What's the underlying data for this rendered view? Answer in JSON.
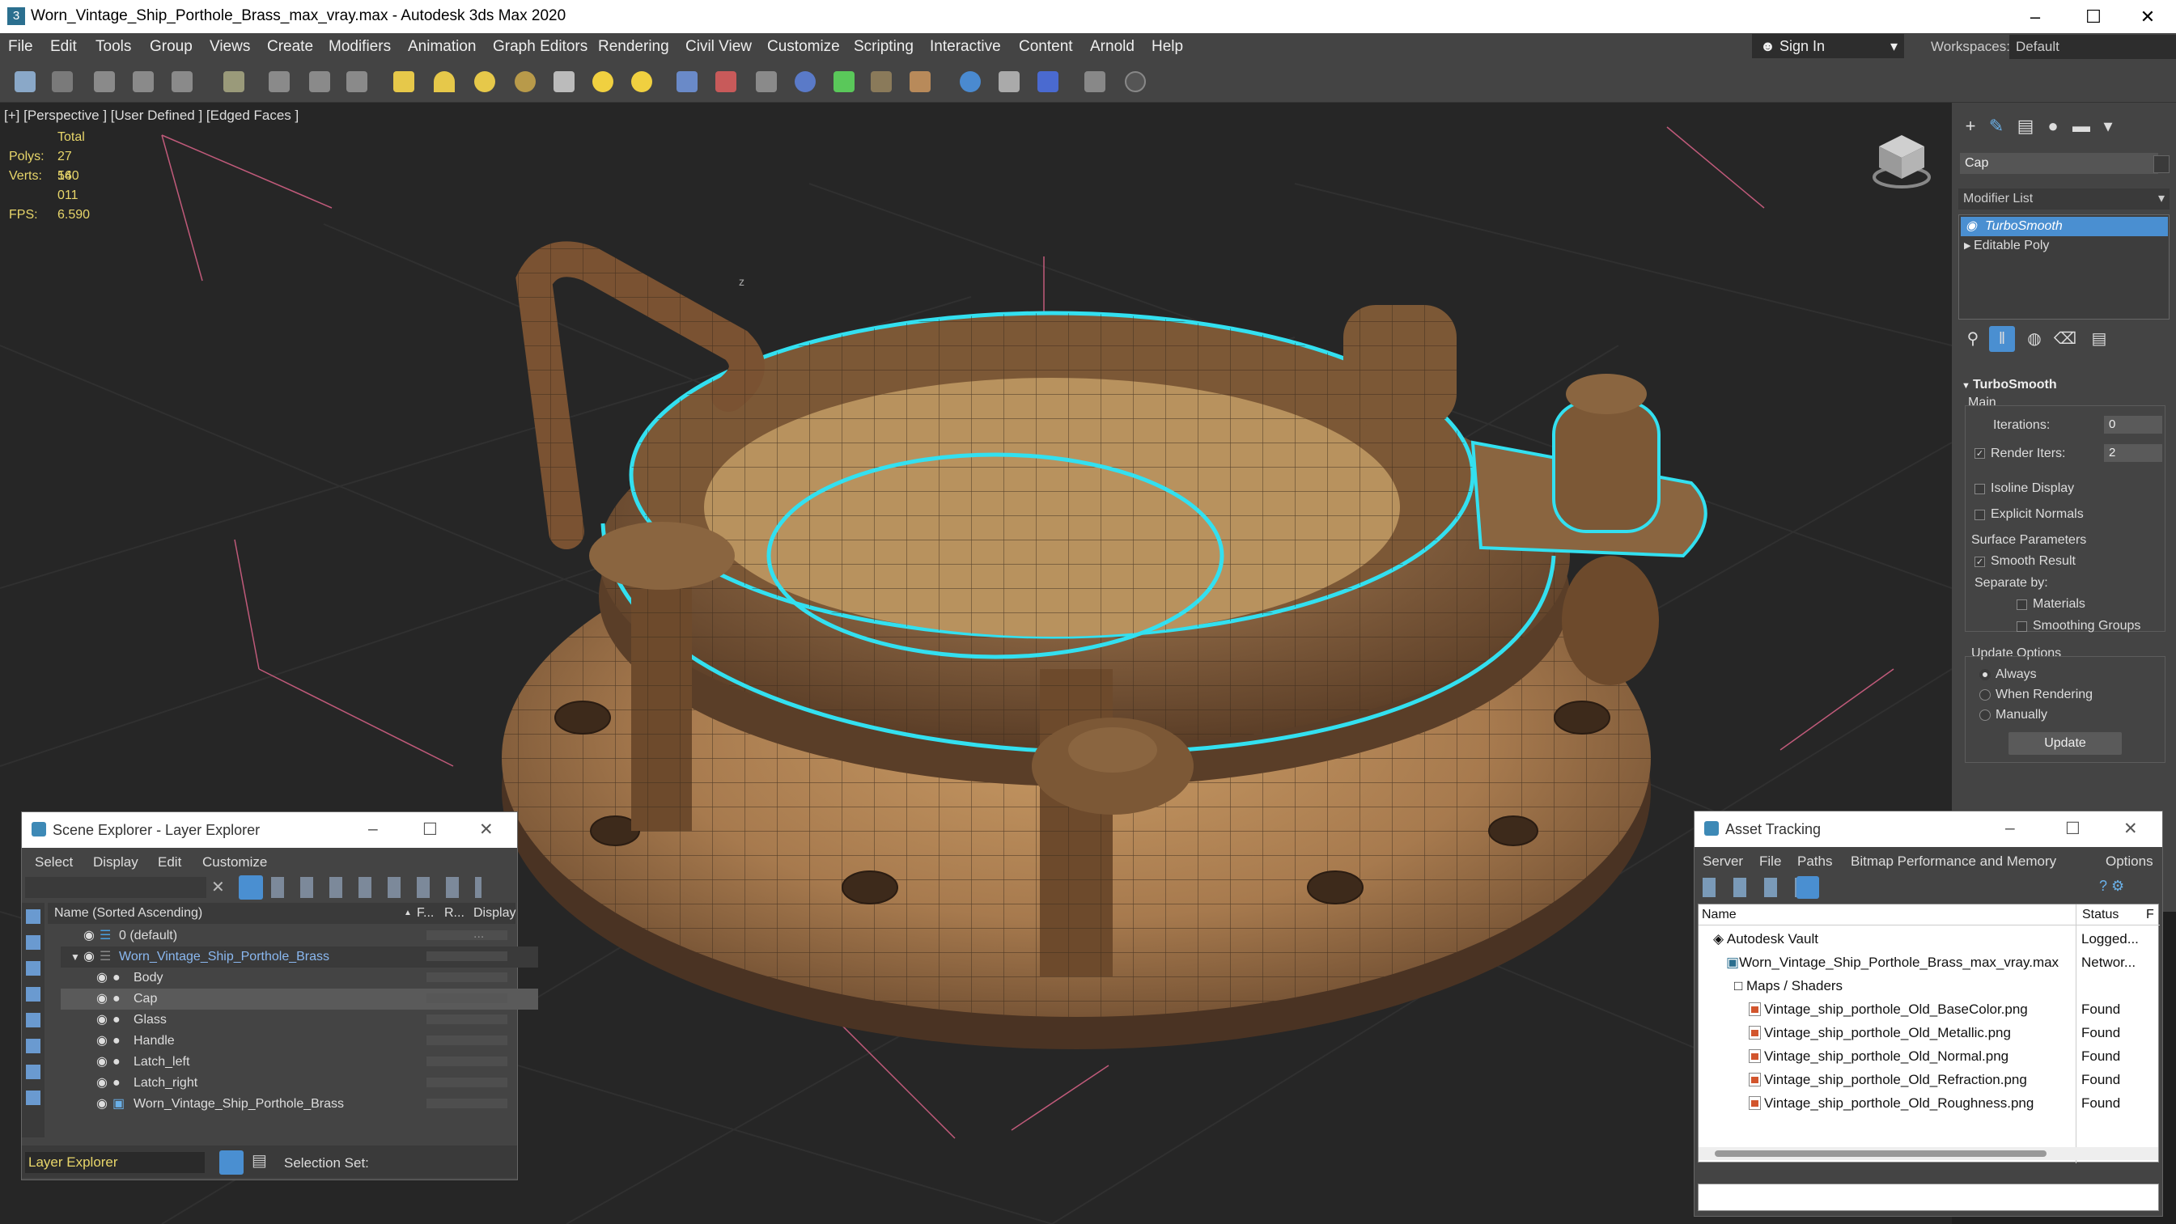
{
  "window": {
    "title": "Worn_Vintage_Ship_Porthole_Brass_max_vray.max - Autodesk 3ds Max 2020",
    "app_icon": "3",
    "minimize": "–",
    "maximize": "☐",
    "close": "✕"
  },
  "menu": [
    "File",
    "Edit",
    "Tools",
    "Group",
    "Views",
    "Create",
    "Modifiers",
    "Animation",
    "Graph Editors",
    "Rendering",
    "Civil View",
    "Customize",
    "Scripting",
    "Interactive",
    "Content",
    "Arnold",
    "Help"
  ],
  "account": {
    "signin": "Sign In",
    "workspaces_label": "Workspaces:",
    "workspace": "Default"
  },
  "viewport": {
    "label": "[+] [Perspective ] [User Defined ] [Edged Faces ]",
    "stats": {
      "total_label": "Total",
      "polys_label": "Polys:",
      "polys": "27 560",
      "verts_label": "Verts:",
      "verts": "14 011",
      "fps_label": "FPS:",
      "fps": "6.590"
    }
  },
  "command_panel": {
    "object_name": "Cap",
    "modifier_list_label": "Modifier List",
    "stack": [
      "TurboSmooth",
      "Editable Poly"
    ],
    "rollout": {
      "title": "TurboSmooth",
      "main_label": "Main",
      "iterations_label": "Iterations:",
      "iterations": "0",
      "render_iters_label": "Render Iters:",
      "render_iters": "2",
      "render_iters_checked": "✓",
      "isoline_label": "Isoline Display",
      "explicit_normals_label": "Explicit Normals",
      "surface_params_label": "Surface Parameters",
      "smooth_result_label": "Smooth Result",
      "smooth_result_checked": "✓",
      "separate_by_label": "Separate by:",
      "materials_label": "Materials",
      "smoothing_groups_label": "Smoothing Groups",
      "update_options_label": "Update Options",
      "always_label": "Always",
      "when_rendering_label": "When Rendering",
      "manually_label": "Manually",
      "update_button": "Update"
    }
  },
  "scene_explorer": {
    "title": "Scene Explorer - Layer Explorer",
    "menu": [
      "Select",
      "Display",
      "Edit",
      "Customize"
    ],
    "columns": {
      "name": "Name (Sorted Ascending)",
      "sort_arrow": "▲",
      "frozen": "F...",
      "render": "R...",
      "display": "Display ..."
    },
    "rows": [
      {
        "name": "0 (default)",
        "indent": 1
      },
      {
        "name": "Worn_Vintage_Ship_Porthole_Brass",
        "indent": 1
      },
      {
        "name": "Body",
        "indent": 2
      },
      {
        "name": "Cap",
        "indent": 2
      },
      {
        "name": "Glass",
        "indent": 2
      },
      {
        "name": "Handle",
        "indent": 2
      },
      {
        "name": "Latch_left",
        "indent": 2
      },
      {
        "name": "Latch_right",
        "indent": 2
      },
      {
        "name": "Worn_Vintage_Ship_Porthole_Brass",
        "indent": 2
      }
    ],
    "footer_label": "Layer Explorer",
    "selection_set_label": "Selection Set:"
  },
  "asset_tracking": {
    "title": "Asset Tracking",
    "menu": [
      "Server",
      "File",
      "Paths",
      "Bitmap Performance and Memory",
      "Options"
    ],
    "columns": {
      "name": "Name",
      "status": "Status",
      "extra": "F"
    },
    "rows": [
      {
        "name": "Autodesk Vault",
        "status": "Logged...",
        "indent": 1
      },
      {
        "name": "Worn_Vintage_Ship_Porthole_Brass_max_vray.max",
        "status": "Networ...",
        "indent": 2
      },
      {
        "name": "Maps / Shaders",
        "status": "",
        "indent": 3
      },
      {
        "name": "Vintage_ship_porthole_Old_BaseColor.png",
        "status": "Found",
        "indent": 4
      },
      {
        "name": "Vintage_ship_porthole_Old_Metallic.png",
        "status": "Found",
        "indent": 4
      },
      {
        "name": "Vintage_ship_porthole_Old_Normal.png",
        "status": "Found",
        "indent": 4
      },
      {
        "name": "Vintage_ship_porthole_Old_Refraction.png",
        "status": "Found",
        "indent": 4
      },
      {
        "name": "Vintage_ship_porthole_Old_Roughness.png",
        "status": "Found",
        "indent": 4
      }
    ]
  },
  "colors": {
    "accent": "#4a8fd1",
    "stats": "#e8d66a",
    "selection_outline": "#33e0f0",
    "brass": "#a77a4e"
  }
}
